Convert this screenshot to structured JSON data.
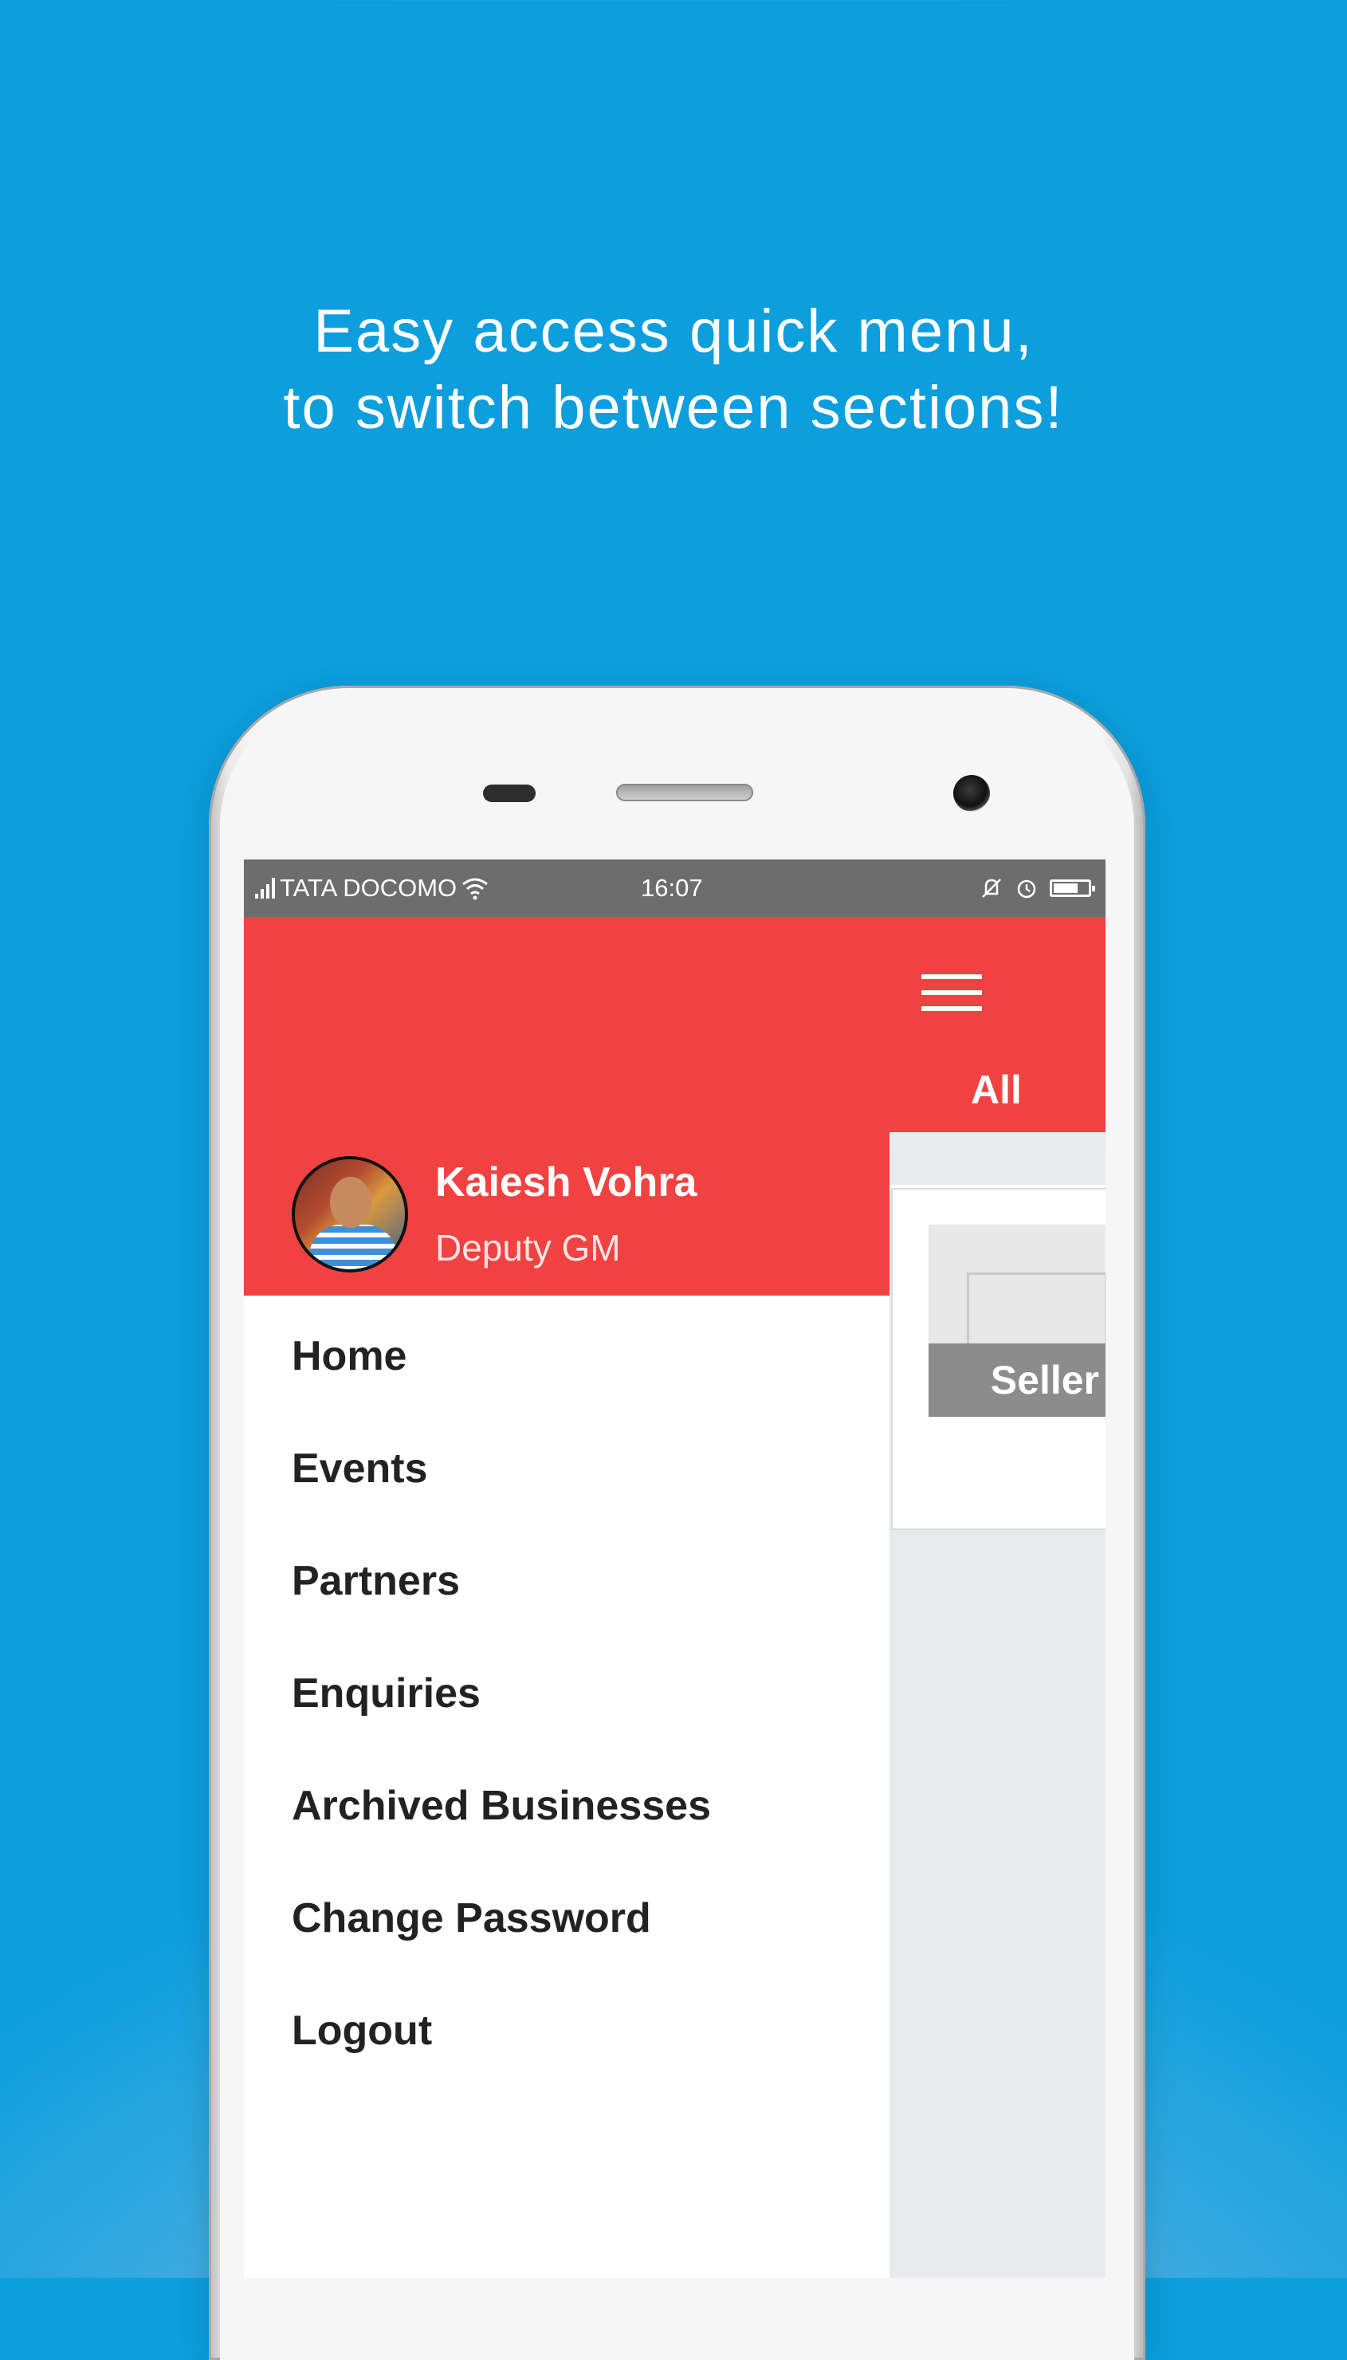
{
  "promo": {
    "line1": "Easy access quick menu,",
    "line2": "to switch between sections!"
  },
  "status_bar": {
    "carrier": "TATA DOCOMO",
    "time": "16:07",
    "icons": [
      "signal-icon",
      "wifi-icon",
      "mute-icon",
      "alarm-icon",
      "battery-icon"
    ]
  },
  "app": {
    "tab_label": "All",
    "card_label": "Seller"
  },
  "drawer": {
    "user_name": "Kaiesh Vohra",
    "user_role": "Deputy GM",
    "menu": [
      "Home",
      "Events",
      "Partners",
      "Enquiries",
      "Archived Businesses",
      "Change Password",
      "Logout"
    ]
  },
  "colors": {
    "accent": "#ef4241",
    "background_top": "#0c9edd",
    "status_bar": "#6d6d6d"
  }
}
